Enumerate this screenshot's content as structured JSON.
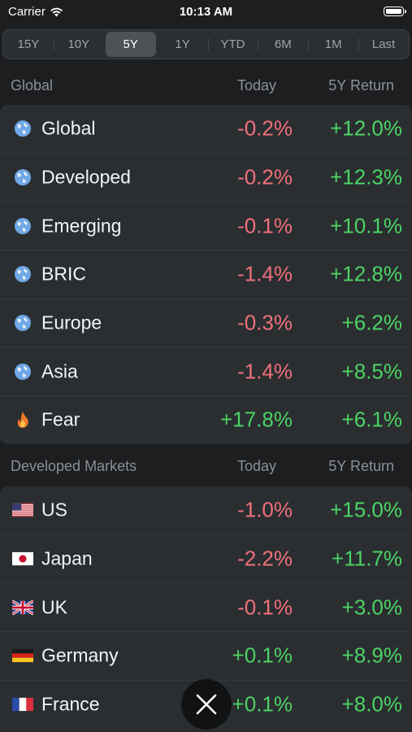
{
  "status_bar": {
    "carrier": "Carrier",
    "time": "10:13 AM"
  },
  "periods": {
    "items": [
      "15Y",
      "10Y",
      "5Y",
      "1Y",
      "YTD",
      "6M",
      "1M",
      "Last"
    ],
    "selected": "5Y"
  },
  "global_section": {
    "title": "Global",
    "col_today": "Today",
    "col_return": "5Y Return",
    "rows": [
      {
        "label": "Global",
        "today": "-0.2%",
        "ret": "+12.0%",
        "icon": "globe-icon"
      },
      {
        "label": "Developed",
        "today": "-0.2%",
        "ret": "+12.3%",
        "icon": "globe-icon"
      },
      {
        "label": "Emerging",
        "today": "-0.1%",
        "ret": "+10.1%",
        "icon": "globe-icon"
      },
      {
        "label": "BRIC",
        "today": "-1.4%",
        "ret": "+12.8%",
        "icon": "globe-icon"
      },
      {
        "label": "Europe",
        "today": "-0.3%",
        "ret": "+6.2%",
        "icon": "globe-icon"
      },
      {
        "label": "Asia",
        "today": "-1.4%",
        "ret": "+8.5%",
        "icon": "globe-icon"
      },
      {
        "label": "Fear",
        "today": "+17.8%",
        "ret": "+6.1%",
        "icon": "fire-icon"
      }
    ]
  },
  "developed_section": {
    "title": "Developed Markets",
    "col_today": "Today",
    "col_return": "5Y Return",
    "rows": [
      {
        "label": "US",
        "today": "-1.0%",
        "ret": "+15.0%",
        "icon": "us-flag-icon"
      },
      {
        "label": "Japan",
        "today": "-2.2%",
        "ret": "+11.7%",
        "icon": "japan-flag-icon"
      },
      {
        "label": "UK",
        "today": "-0.1%",
        "ret": "+3.0%",
        "icon": "uk-flag-icon"
      },
      {
        "label": "Germany",
        "today": "+0.1%",
        "ret": "+8.9%",
        "icon": "germany-flag-icon"
      },
      {
        "label": "France",
        "today": "+0.1%",
        "ret": "+8.0%",
        "icon": "france-flag-icon"
      }
    ]
  },
  "colors": {
    "negative": "#f0707a",
    "positive": "#4cd364",
    "background": "#1c1e20",
    "card": "#2a2e31"
  }
}
